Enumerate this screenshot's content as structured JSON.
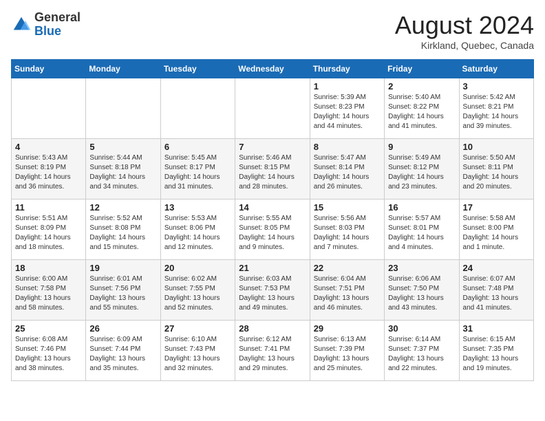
{
  "header": {
    "logo_general": "General",
    "logo_blue": "Blue",
    "month_year": "August 2024",
    "location": "Kirkland, Quebec, Canada"
  },
  "days_of_week": [
    "Sunday",
    "Monday",
    "Tuesday",
    "Wednesday",
    "Thursday",
    "Friday",
    "Saturday"
  ],
  "weeks": [
    [
      {
        "day": "",
        "info": ""
      },
      {
        "day": "",
        "info": ""
      },
      {
        "day": "",
        "info": ""
      },
      {
        "day": "",
        "info": ""
      },
      {
        "day": "1",
        "info": "Sunrise: 5:39 AM\nSunset: 8:23 PM\nDaylight: 14 hours\nand 44 minutes."
      },
      {
        "day": "2",
        "info": "Sunrise: 5:40 AM\nSunset: 8:22 PM\nDaylight: 14 hours\nand 41 minutes."
      },
      {
        "day": "3",
        "info": "Sunrise: 5:42 AM\nSunset: 8:21 PM\nDaylight: 14 hours\nand 39 minutes."
      }
    ],
    [
      {
        "day": "4",
        "info": "Sunrise: 5:43 AM\nSunset: 8:19 PM\nDaylight: 14 hours\nand 36 minutes."
      },
      {
        "day": "5",
        "info": "Sunrise: 5:44 AM\nSunset: 8:18 PM\nDaylight: 14 hours\nand 34 minutes."
      },
      {
        "day": "6",
        "info": "Sunrise: 5:45 AM\nSunset: 8:17 PM\nDaylight: 14 hours\nand 31 minutes."
      },
      {
        "day": "7",
        "info": "Sunrise: 5:46 AM\nSunset: 8:15 PM\nDaylight: 14 hours\nand 28 minutes."
      },
      {
        "day": "8",
        "info": "Sunrise: 5:47 AM\nSunset: 8:14 PM\nDaylight: 14 hours\nand 26 minutes."
      },
      {
        "day": "9",
        "info": "Sunrise: 5:49 AM\nSunset: 8:12 PM\nDaylight: 14 hours\nand 23 minutes."
      },
      {
        "day": "10",
        "info": "Sunrise: 5:50 AM\nSunset: 8:11 PM\nDaylight: 14 hours\nand 20 minutes."
      }
    ],
    [
      {
        "day": "11",
        "info": "Sunrise: 5:51 AM\nSunset: 8:09 PM\nDaylight: 14 hours\nand 18 minutes."
      },
      {
        "day": "12",
        "info": "Sunrise: 5:52 AM\nSunset: 8:08 PM\nDaylight: 14 hours\nand 15 minutes."
      },
      {
        "day": "13",
        "info": "Sunrise: 5:53 AM\nSunset: 8:06 PM\nDaylight: 14 hours\nand 12 minutes."
      },
      {
        "day": "14",
        "info": "Sunrise: 5:55 AM\nSunset: 8:05 PM\nDaylight: 14 hours\nand 9 minutes."
      },
      {
        "day": "15",
        "info": "Sunrise: 5:56 AM\nSunset: 8:03 PM\nDaylight: 14 hours\nand 7 minutes."
      },
      {
        "day": "16",
        "info": "Sunrise: 5:57 AM\nSunset: 8:01 PM\nDaylight: 14 hours\nand 4 minutes."
      },
      {
        "day": "17",
        "info": "Sunrise: 5:58 AM\nSunset: 8:00 PM\nDaylight: 14 hours\nand 1 minute."
      }
    ],
    [
      {
        "day": "18",
        "info": "Sunrise: 6:00 AM\nSunset: 7:58 PM\nDaylight: 13 hours\nand 58 minutes."
      },
      {
        "day": "19",
        "info": "Sunrise: 6:01 AM\nSunset: 7:56 PM\nDaylight: 13 hours\nand 55 minutes."
      },
      {
        "day": "20",
        "info": "Sunrise: 6:02 AM\nSunset: 7:55 PM\nDaylight: 13 hours\nand 52 minutes."
      },
      {
        "day": "21",
        "info": "Sunrise: 6:03 AM\nSunset: 7:53 PM\nDaylight: 13 hours\nand 49 minutes."
      },
      {
        "day": "22",
        "info": "Sunrise: 6:04 AM\nSunset: 7:51 PM\nDaylight: 13 hours\nand 46 minutes."
      },
      {
        "day": "23",
        "info": "Sunrise: 6:06 AM\nSunset: 7:50 PM\nDaylight: 13 hours\nand 43 minutes."
      },
      {
        "day": "24",
        "info": "Sunrise: 6:07 AM\nSunset: 7:48 PM\nDaylight: 13 hours\nand 41 minutes."
      }
    ],
    [
      {
        "day": "25",
        "info": "Sunrise: 6:08 AM\nSunset: 7:46 PM\nDaylight: 13 hours\nand 38 minutes."
      },
      {
        "day": "26",
        "info": "Sunrise: 6:09 AM\nSunset: 7:44 PM\nDaylight: 13 hours\nand 35 minutes."
      },
      {
        "day": "27",
        "info": "Sunrise: 6:10 AM\nSunset: 7:43 PM\nDaylight: 13 hours\nand 32 minutes."
      },
      {
        "day": "28",
        "info": "Sunrise: 6:12 AM\nSunset: 7:41 PM\nDaylight: 13 hours\nand 29 minutes."
      },
      {
        "day": "29",
        "info": "Sunrise: 6:13 AM\nSunset: 7:39 PM\nDaylight: 13 hours\nand 25 minutes."
      },
      {
        "day": "30",
        "info": "Sunrise: 6:14 AM\nSunset: 7:37 PM\nDaylight: 13 hours\nand 22 minutes."
      },
      {
        "day": "31",
        "info": "Sunrise: 6:15 AM\nSunset: 7:35 PM\nDaylight: 13 hours\nand 19 minutes."
      }
    ]
  ]
}
